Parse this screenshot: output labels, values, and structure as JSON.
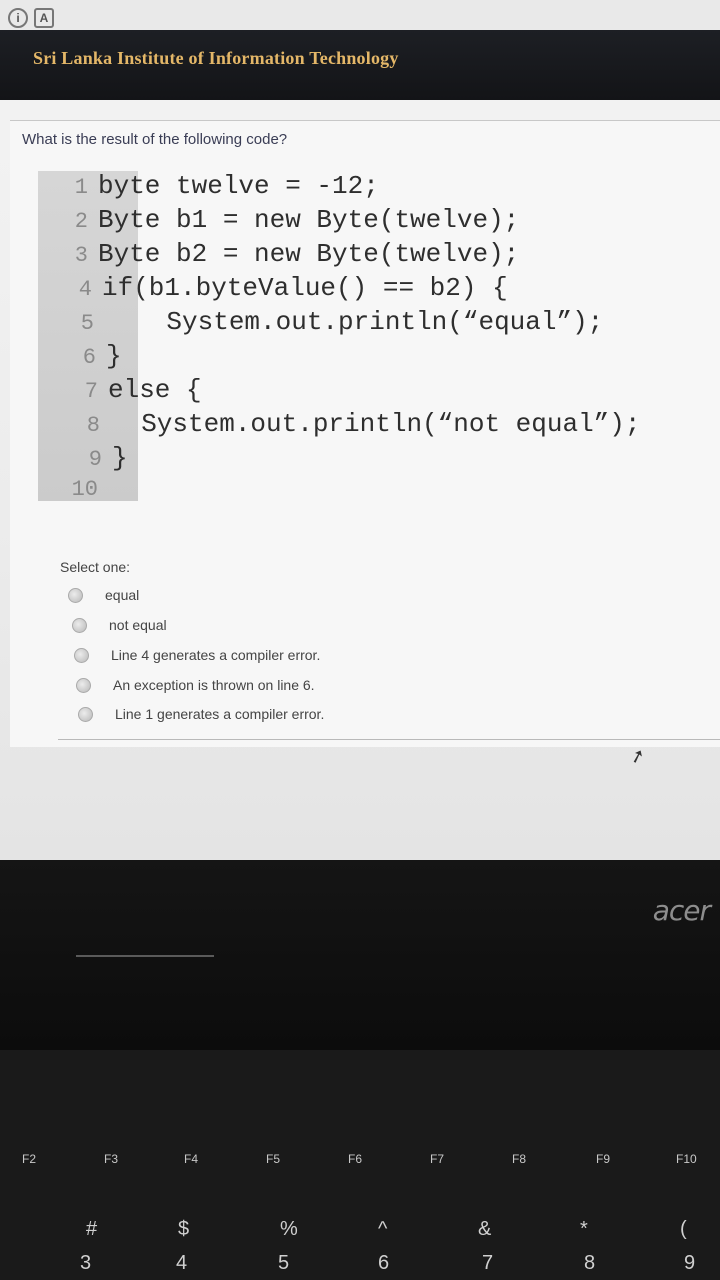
{
  "banner": {
    "title": "Sri Lanka Institute of Information Technology"
  },
  "top_icons": [
    {
      "name": "power-icon",
      "glyph": "i"
    },
    {
      "name": "app-icon",
      "glyph": "A"
    }
  ],
  "question": {
    "text": "What is the result of the following code?"
  },
  "code": {
    "lines": [
      {
        "num": "1",
        "text": "byte twelve = -12;"
      },
      {
        "num": "2",
        "text": "Byte b1 = new Byte(twelve);"
      },
      {
        "num": "3",
        "text": "Byte b2 = new Byte(twelve);"
      },
      {
        "num": "4",
        "text": "if(b1.byteValue() == b2) {"
      },
      {
        "num": "5",
        "text": "    System.out.println(“equal”);"
      },
      {
        "num": "6",
        "text": "}"
      },
      {
        "num": "7",
        "text": "else {"
      },
      {
        "num": "8",
        "text": "  System.out.println(“not equal”);"
      },
      {
        "num": "9",
        "text": "}"
      },
      {
        "num": "10",
        "text": ""
      }
    ]
  },
  "answers": {
    "label": "Select one:",
    "options": [
      {
        "label": "equal"
      },
      {
        "label": "not equal"
      },
      {
        "label": "Line 4 generates a compiler error."
      },
      {
        "label": "An exception is thrown on line 6."
      },
      {
        "label": "Line 1 generates a compiler error."
      }
    ]
  },
  "laptop": {
    "brand": "acer",
    "function_keys": [
      "F2",
      "F3",
      "F4",
      "F5",
      "F6",
      "F7",
      "F8",
      "F9",
      "F10"
    ],
    "number_row_symbols": [
      "#",
      "$",
      "%",
      "^",
      "&",
      "*",
      "("
    ],
    "number_row_digits": [
      "3",
      "4",
      "5",
      "6",
      "7",
      "8",
      "9"
    ]
  }
}
